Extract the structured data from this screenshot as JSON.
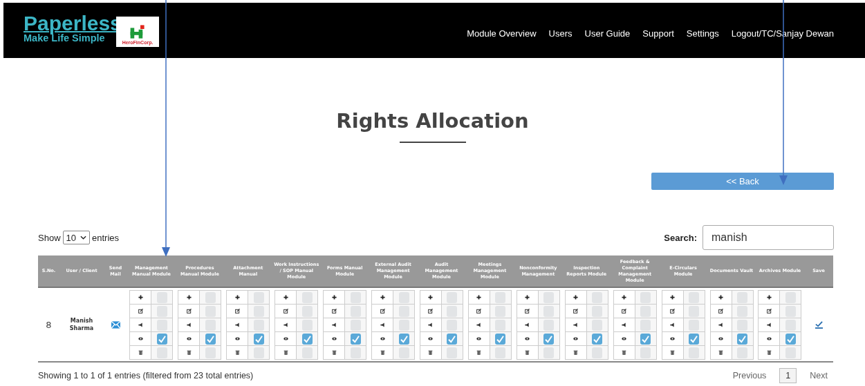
{
  "brand": {
    "name": "Paperless",
    "tagline": "Make Life Simple",
    "partner": "HeroFinCorp."
  },
  "nav": [
    "Module Overview",
    "Users",
    "User Guide",
    "Support",
    "Settings",
    "Logout/TC/Sanjay Dewan"
  ],
  "title": "Rights Allocation",
  "back_button": "<< Back",
  "length": {
    "label_before": "Show",
    "value": "10",
    "label_after": "entries"
  },
  "search": {
    "label": "Search:",
    "value": "manish"
  },
  "columns": [
    "S.No.",
    "User / Client",
    "Send Mail",
    "Management Manual Module",
    "Procedures Manual Module",
    "Attachment Manual",
    "Work Instructions / SOP Manual Module",
    "Forms Manual Module",
    "External Audit Management Module",
    "Audit Management Module",
    "Meetings Management Module",
    "Nonconformity Management",
    "Inspection Reports Module",
    "Feedback & Complaint Management Module",
    "E-Circulars Module",
    "Documents Vault",
    "Archives Module",
    "Save"
  ],
  "rows": [
    {
      "sno": "8",
      "user": "Manish Sharma",
      "modules": [
        {
          "permissions": [
            {
              "kind": "add",
              "checked": false
            },
            {
              "kind": "edit",
              "checked": false
            },
            {
              "kind": "publish",
              "checked": false
            },
            {
              "kind": "view",
              "checked": true
            },
            {
              "kind": "delete",
              "checked": false
            }
          ]
        },
        {
          "permissions": [
            {
              "kind": "add",
              "checked": false
            },
            {
              "kind": "edit",
              "checked": false
            },
            {
              "kind": "publish",
              "checked": false
            },
            {
              "kind": "view",
              "checked": true
            },
            {
              "kind": "delete",
              "checked": false
            }
          ]
        },
        {
          "permissions": [
            {
              "kind": "add",
              "checked": false
            },
            {
              "kind": "edit",
              "checked": false
            },
            {
              "kind": "publish",
              "checked": false
            },
            {
              "kind": "view",
              "checked": true
            },
            {
              "kind": "delete",
              "checked": false
            }
          ]
        },
        {
          "permissions": [
            {
              "kind": "add",
              "checked": false
            },
            {
              "kind": "edit",
              "checked": false
            },
            {
              "kind": "publish",
              "checked": false
            },
            {
              "kind": "view",
              "checked": true
            },
            {
              "kind": "delete",
              "checked": false
            }
          ]
        },
        {
          "permissions": [
            {
              "kind": "add",
              "checked": false
            },
            {
              "kind": "edit",
              "checked": false
            },
            {
              "kind": "publish",
              "checked": false
            },
            {
              "kind": "view",
              "checked": true
            },
            {
              "kind": "delete",
              "checked": false
            }
          ]
        },
        {
          "permissions": [
            {
              "kind": "add",
              "checked": false
            },
            {
              "kind": "edit",
              "checked": false
            },
            {
              "kind": "publish",
              "checked": false
            },
            {
              "kind": "view",
              "checked": true
            },
            {
              "kind": "delete",
              "checked": false
            }
          ]
        },
        {
          "permissions": [
            {
              "kind": "add",
              "checked": false
            },
            {
              "kind": "edit",
              "checked": false
            },
            {
              "kind": "publish",
              "checked": false
            },
            {
              "kind": "view",
              "checked": true
            },
            {
              "kind": "delete",
              "checked": false
            }
          ]
        },
        {
          "permissions": [
            {
              "kind": "add",
              "checked": false
            },
            {
              "kind": "edit",
              "checked": false
            },
            {
              "kind": "publish",
              "checked": false
            },
            {
              "kind": "view",
              "checked": true
            },
            {
              "kind": "delete",
              "checked": false
            }
          ]
        },
        {
          "permissions": [
            {
              "kind": "add",
              "checked": false
            },
            {
              "kind": "edit",
              "checked": false
            },
            {
              "kind": "publish",
              "checked": false
            },
            {
              "kind": "view",
              "checked": true
            },
            {
              "kind": "delete",
              "checked": false
            }
          ]
        },
        {
          "permissions": [
            {
              "kind": "add",
              "checked": false
            },
            {
              "kind": "edit",
              "checked": false
            },
            {
              "kind": "publish",
              "checked": false
            },
            {
              "kind": "view",
              "checked": true
            },
            {
              "kind": "delete",
              "checked": false
            }
          ]
        },
        {
          "permissions": [
            {
              "kind": "add",
              "checked": false
            },
            {
              "kind": "edit",
              "checked": false
            },
            {
              "kind": "publish",
              "checked": false
            },
            {
              "kind": "view",
              "checked": true
            },
            {
              "kind": "delete",
              "checked": false
            }
          ]
        },
        {
          "permissions": [
            {
              "kind": "add",
              "checked": false
            },
            {
              "kind": "edit",
              "checked": false
            },
            {
              "kind": "publish",
              "checked": false
            },
            {
              "kind": "view",
              "checked": true
            },
            {
              "kind": "delete",
              "checked": false
            }
          ]
        },
        {
          "permissions": [
            {
              "kind": "add",
              "checked": false
            },
            {
              "kind": "edit",
              "checked": false
            },
            {
              "kind": "publish",
              "checked": false
            },
            {
              "kind": "view",
              "checked": true
            },
            {
              "kind": "delete",
              "checked": false
            }
          ]
        },
        {
          "permissions": [
            {
              "kind": "add",
              "checked": false
            },
            {
              "kind": "edit",
              "checked": false
            },
            {
              "kind": "publish",
              "checked": false
            },
            {
              "kind": "view",
              "checked": true
            },
            {
              "kind": "delete",
              "checked": false
            }
          ]
        }
      ]
    }
  ],
  "info": "Showing 1 to 1 of 1 entries (filtered from 23 total entries)",
  "pagination": [
    {
      "label": "Previous",
      "selected": false
    },
    {
      "label": "1",
      "selected": true
    },
    {
      "label": "Next",
      "selected": false
    }
  ]
}
